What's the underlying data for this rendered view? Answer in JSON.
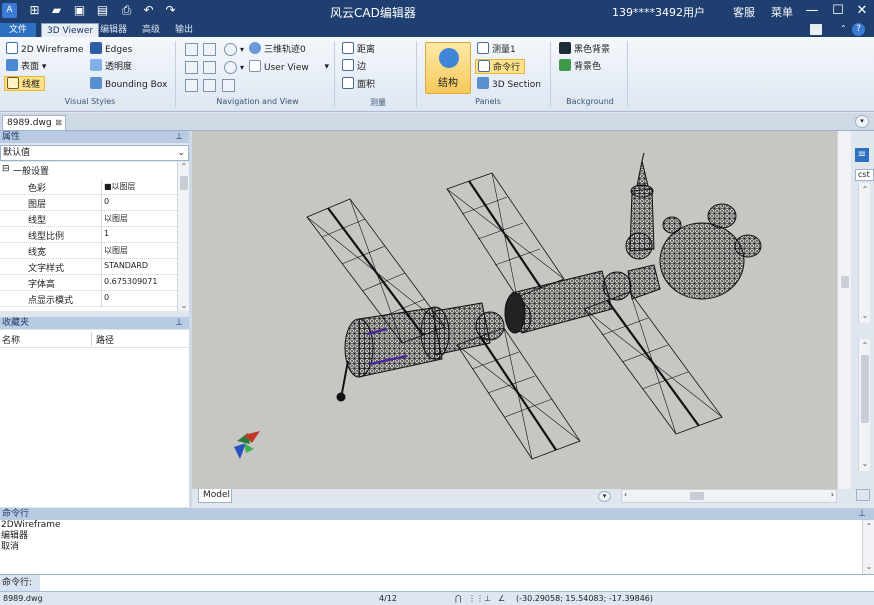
{
  "title": {
    "app_title": "风云CAD编辑器",
    "user": "139****3492用户",
    "support": "客服",
    "menu": "菜单"
  },
  "ribbon_tabs": [
    "文件",
    "3D Viewer",
    "编辑器",
    "高级",
    "输出"
  ],
  "visual_styles": {
    "wireframe": "2D Wireframe",
    "surface": "表面",
    "frame": "线框",
    "edges": "Edges",
    "transparency": "透明度",
    "bounding_box": "Bounding Box",
    "group_label": "Visual Styles"
  },
  "navigation": {
    "orbit": "三维轨迹0",
    "user_view": "User View",
    "group_label": "Navigation and View"
  },
  "measure": {
    "distance": "距离",
    "edge": "边",
    "area": "面积",
    "group_label": "测量"
  },
  "panels": {
    "structure": "结构",
    "measure1": "测量1",
    "command_line": "命令行",
    "section": "3D Section",
    "group_label": "Panels"
  },
  "background": {
    "black": "黑色背景",
    "bg_color": "背景色",
    "group_label": "Background"
  },
  "document_tab": "8989.dwg",
  "properties": {
    "header": "属性",
    "dropdown_value": "默认值",
    "section": "一般设置",
    "rows": [
      {
        "key": "色彩",
        "value": "■以图层"
      },
      {
        "key": "图层",
        "value": "0"
      },
      {
        "key": "线型",
        "value": "以图层"
      },
      {
        "key": "线型比例",
        "value": "1"
      },
      {
        "key": "线宽",
        "value": "以图层"
      },
      {
        "key": "文字样式",
        "value": "STANDARD"
      },
      {
        "key": "字体高",
        "value": "0.675309071"
      },
      {
        "key": "点显示模式",
        "value": "0"
      }
    ]
  },
  "favorites": {
    "header": "收藏夹",
    "col_name": "名称",
    "col_path": "路径"
  },
  "model_tab": "Model",
  "right_panel_tab": "cst",
  "command": {
    "header": "命令行",
    "history": [
      "2DWireframe",
      "编辑器",
      "取消"
    ],
    "prompt_label": "命令行:"
  },
  "status": {
    "file": "8989.dwg",
    "page": "4/12",
    "coords": "(-30.29058; 15.54083; -17.39846)"
  },
  "colors": {
    "titlebar": "#1f3f70",
    "accent": "#2d6fc1",
    "viewport_bg": "#c6c7c3",
    "panel_header": "#b9cbe2"
  }
}
